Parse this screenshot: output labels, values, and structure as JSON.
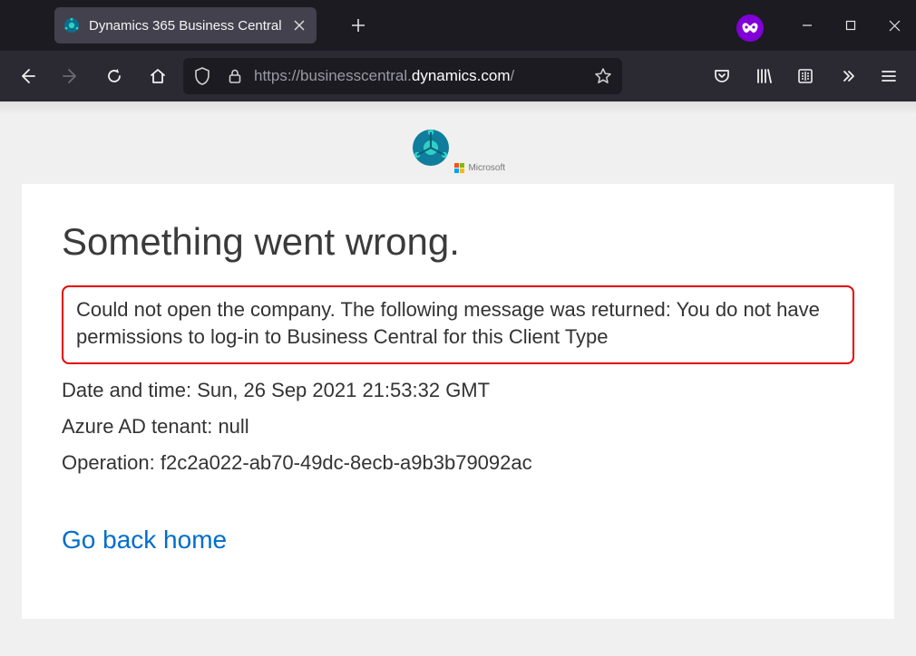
{
  "tab": {
    "title": "Dynamics 365 Business Central"
  },
  "url": {
    "proto": "https://",
    "sub": "businesscentral.",
    "dom": "dynamics.com",
    "path": "/"
  },
  "mslogo_text": "Microsoft",
  "page": {
    "heading": "Something went wrong.",
    "error_msg": "Could not open the company. The following message was returned: You do not have permissions to log-in to Business Central for this Client Type",
    "datetime_label": "Date and time: ",
    "datetime_value": "Sun, 26 Sep 2021 21:53:32 GMT",
    "tenant_label": "Azure AD tenant: ",
    "tenant_value": "null",
    "operation_label": "Operation: ",
    "operation_value": "f2c2a022-ab70-49dc-8ecb-a9b3b79092ac",
    "home_link": "Go back home"
  }
}
